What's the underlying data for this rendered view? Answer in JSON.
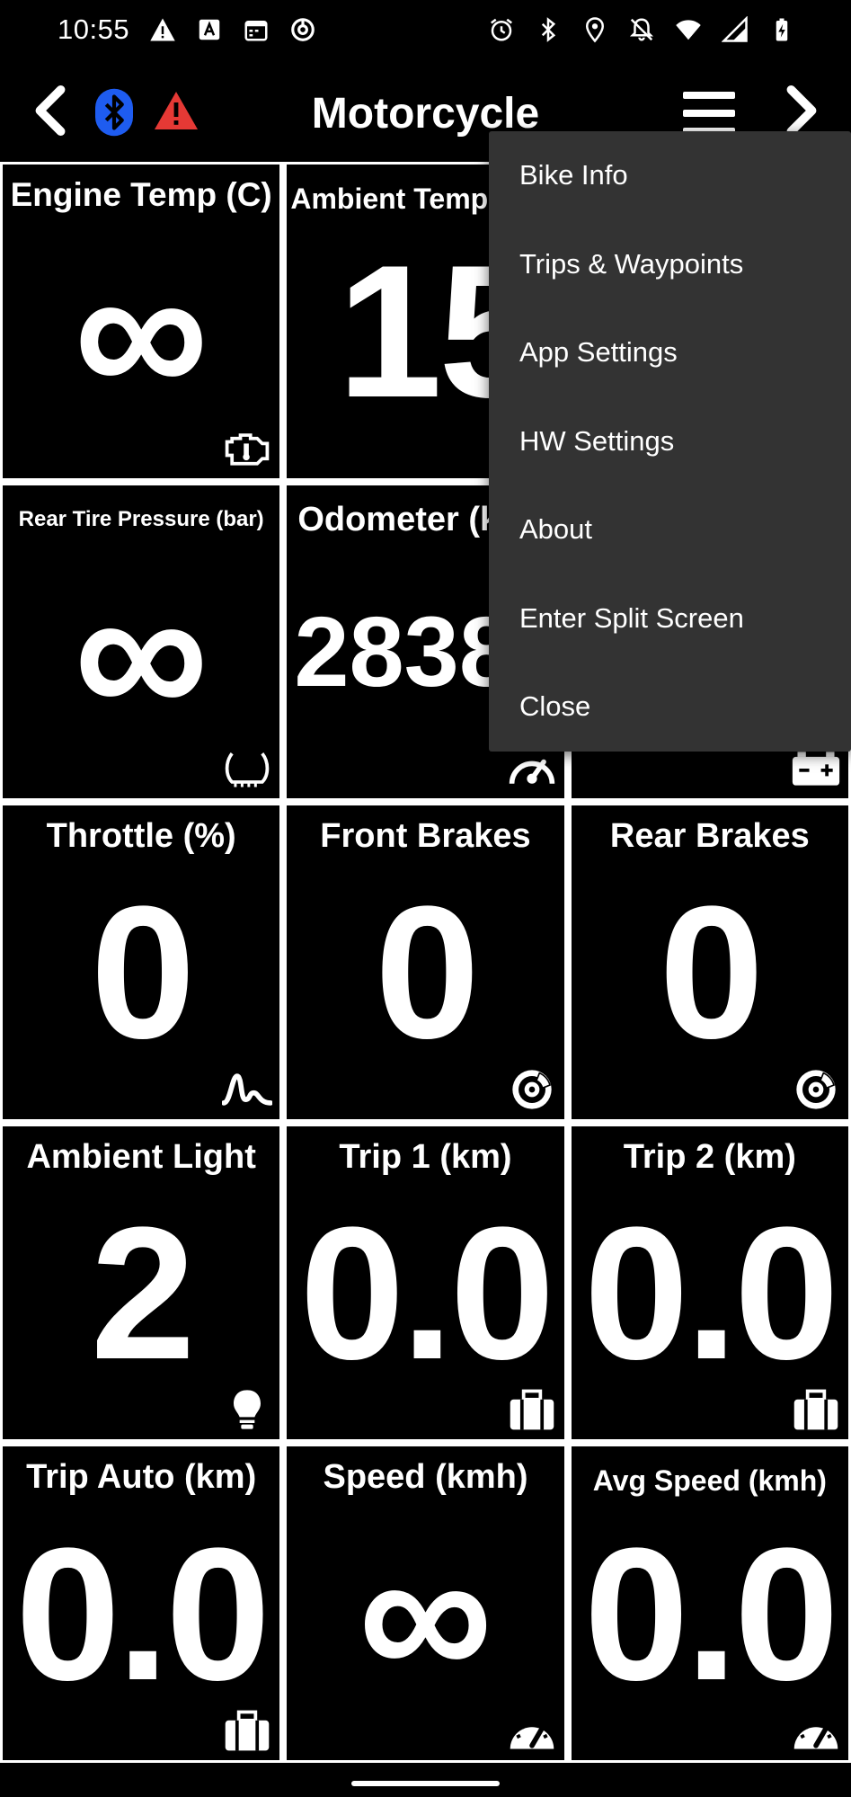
{
  "status_bar": {
    "time": "10:55"
  },
  "toolbar": {
    "title": "Motorcycle",
    "colors": {
      "bluetooth": "#1e5cf0",
      "warning": "#e53935"
    }
  },
  "tiles": [
    {
      "label": "Engine Temp (C)",
      "value": "∞",
      "icon": "engine-icon"
    },
    {
      "label": "Ambient Temp (C)",
      "value": "15",
      "icon": "thermometer-icon"
    },
    {
      "label": "",
      "value": "",
      "icon": ""
    },
    {
      "label": "Rear Tire Pressure (bar)",
      "value": "∞",
      "icon": "tire-icon"
    },
    {
      "label": "Odometer (km)",
      "value": "2838",
      "icon": "speedometer-icon"
    },
    {
      "label": "",
      "value": "",
      "icon": "battery-icon"
    },
    {
      "label": "Throttle (%)",
      "value": "0",
      "icon": "signal-icon"
    },
    {
      "label": "Front Brakes",
      "value": "0",
      "icon": "brake-icon"
    },
    {
      "label": "Rear Brakes",
      "value": "0",
      "icon": "brake-icon"
    },
    {
      "label": "Ambient Light",
      "value": "2",
      "icon": "lightbulb-icon"
    },
    {
      "label": "Trip 1 (km)",
      "value": "0.0",
      "icon": "luggage-icon"
    },
    {
      "label": "Trip 2 (km)",
      "value": "0.0",
      "icon": "luggage-icon"
    },
    {
      "label": "Trip Auto (km)",
      "value": "0.0",
      "icon": "luggage-icon"
    },
    {
      "label": "Speed (kmh)",
      "value": "∞",
      "icon": "gauge-icon"
    },
    {
      "label": "Avg Speed (kmh)",
      "value": "0.0",
      "icon": "gauge-icon"
    }
  ],
  "menu": {
    "items": [
      "Bike Info",
      "Trips & Waypoints",
      "App Settings",
      "HW Settings",
      "About",
      "Enter Split Screen",
      "Close"
    ]
  }
}
